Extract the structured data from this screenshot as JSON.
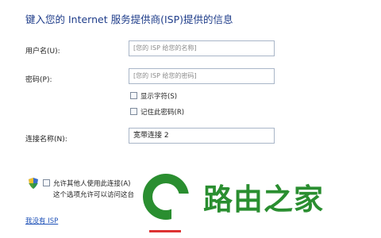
{
  "title": "键入您的 Internet 服务提供商(ISP)提供的信息",
  "form": {
    "username_label": "用户名(U):",
    "username_placeholder": "[您的 ISP 给您的名称]",
    "password_label": "密码(P):",
    "password_placeholder": "[您的 ISP 给您的密码]",
    "show_chars_label": "显示字符(S)",
    "remember_label": "记住此密码(R)",
    "connection_name_label": "连接名称(N):",
    "connection_name_value": "宽带连接 2",
    "allow_others_label": "允许其他人使用此连接(A)",
    "allow_others_desc": "这个选项允许可以访问这台",
    "no_isp_link": "我没有 ISP"
  },
  "watermark": {
    "text": "路由之家",
    "colors": {
      "green": "#2a8e30"
    }
  }
}
